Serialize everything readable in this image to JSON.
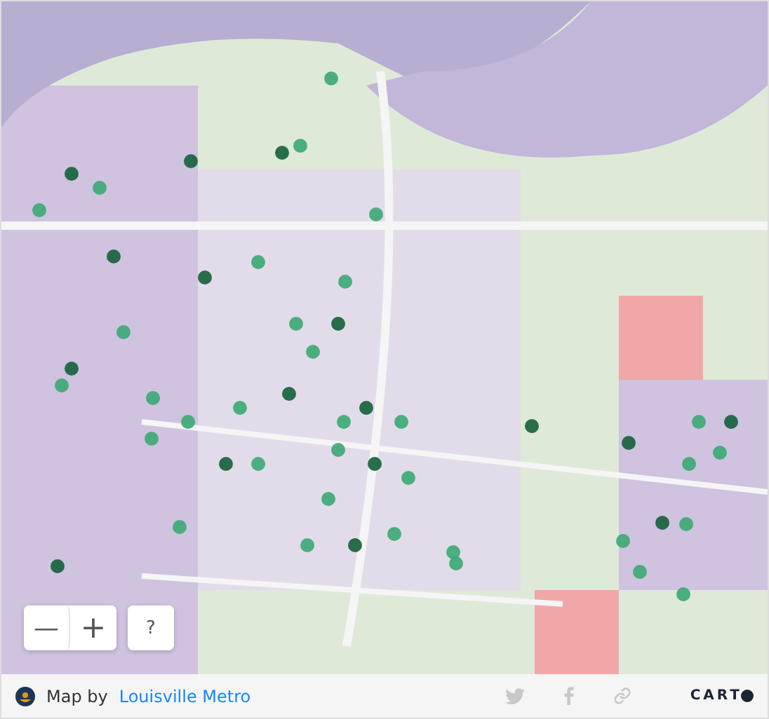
{
  "map_controls": {
    "zoom_out": "—",
    "zoom_in": "+",
    "help": "?"
  },
  "footer": {
    "prefix": "Map by",
    "link": "Louisville Metro",
    "share": [
      {
        "kind": "twitter"
      },
      {
        "kind": "facebook"
      },
      {
        "kind": "link"
      }
    ],
    "logo": "CART"
  }
}
